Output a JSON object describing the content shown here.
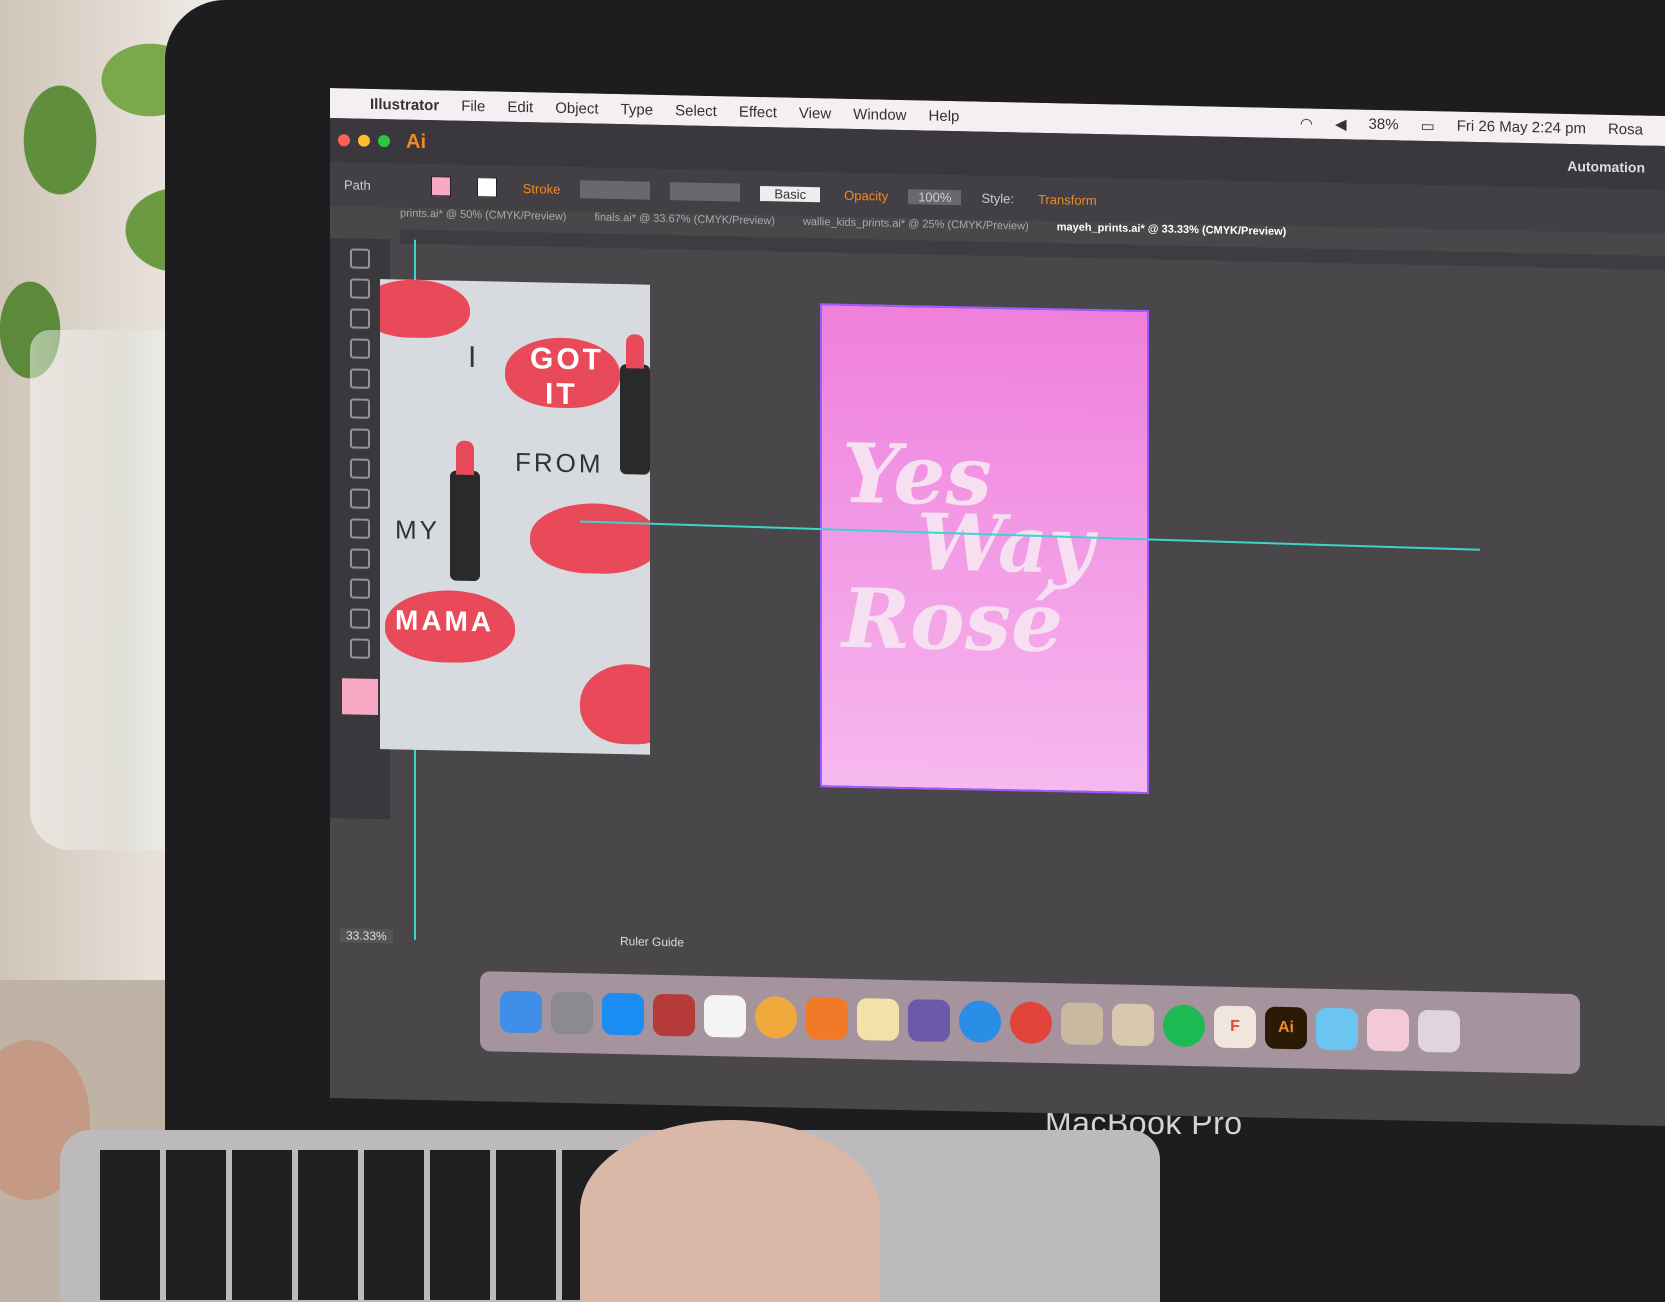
{
  "menubar": {
    "app_name": "Illustrator",
    "items": [
      "File",
      "Edit",
      "Object",
      "Type",
      "Select",
      "Effect",
      "View",
      "Window",
      "Help"
    ],
    "battery": "38%",
    "datetime": "Fri 26 May  2:24 pm",
    "user": "Rosa"
  },
  "illustrator": {
    "logo": "Ai",
    "workspace": "Automation",
    "control_label": "Path",
    "stroke_label": "Stroke",
    "stroke_style": "Basic",
    "opacity_label": "Opacity",
    "opacity_value": "100%",
    "style_label": "Style:",
    "transform_label": "Transform",
    "tabs": [
      "prints.ai* @ 50% (CMYK/Preview)",
      "finals.ai* @ 33.67% (CMYK/Preview)",
      "wallie_kids_prints.ai* @ 25% (CMYK/Preview)",
      "mayeh_prints.ai* @ 33.33% (CMYK/Preview)"
    ],
    "zoom": "33.33%",
    "status": "Ruler Guide"
  },
  "artboard_left": {
    "lines": [
      "I",
      "GOT",
      "IT",
      "FROM",
      "MY",
      "MAMA"
    ]
  },
  "artboard_right": {
    "lines": [
      "Yes",
      "Way",
      "Rosé"
    ],
    "bg_top": "#ef7fdc",
    "bg_bottom": "#f6b8ef"
  },
  "dock": {
    "apps": [
      "finder-icon",
      "launchpad-icon",
      "app-store-icon",
      "dictionary-icon",
      "music-icon",
      "photos-icon",
      "books-icon",
      "notes-icon",
      "quill-icon",
      "safari-icon",
      "chrome-icon",
      "preview-icon",
      "photos2-icon",
      "spotify-icon",
      "F",
      "Ai",
      "folder-icon",
      "downloads-icon",
      "trash-icon"
    ]
  },
  "laptop": {
    "brand": "MacBook Pro"
  }
}
